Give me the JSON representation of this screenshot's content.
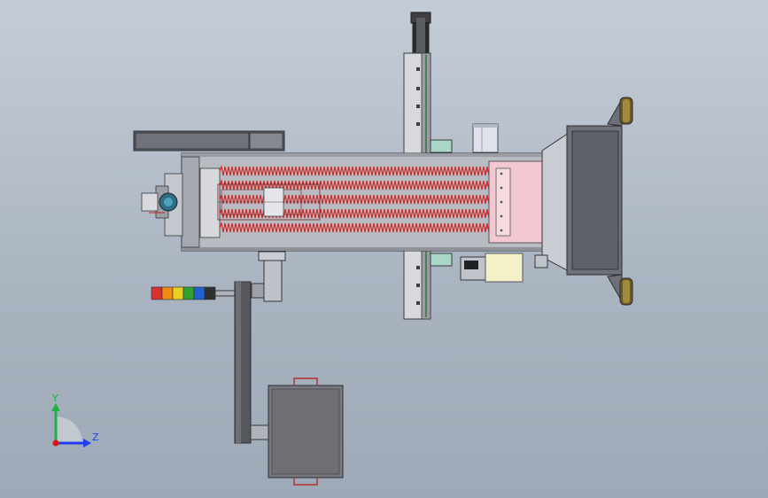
{
  "viewport": {
    "background_top": "#c4ccd7",
    "background_bottom": "#9ea9b7"
  },
  "triad": {
    "y_label": "Y",
    "z_label": "Z",
    "y_color": "#1bb34a",
    "z_color": "#1f3ff0",
    "x_color": "#e01010"
  },
  "colors": {
    "frame": "#b9bcc2",
    "frame_dark": "#5c5f66",
    "housing_dark": "#6a6c72",
    "heater_wire": "#d01818",
    "pink_panel": "#f3c7d0",
    "yellow_box": "#f4f0c8",
    "motor_box": "#77797f",
    "signal_tower": [
      "#d83030",
      "#f08a10",
      "#e8d020",
      "#30a030",
      "#2060d0",
      "#303030"
    ]
  }
}
